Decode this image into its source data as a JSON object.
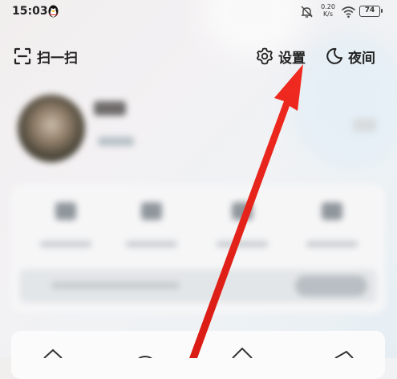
{
  "status_bar": {
    "time": "15:03",
    "net_speed_value": "0.20",
    "net_speed_unit": "K/s",
    "battery": "74"
  },
  "toolbar": {
    "scan_label": "扫一扫",
    "settings_label": "设置",
    "night_label": "夜间"
  },
  "colors": {
    "annotation_arrow": "#e8231c",
    "text": "#222222"
  }
}
